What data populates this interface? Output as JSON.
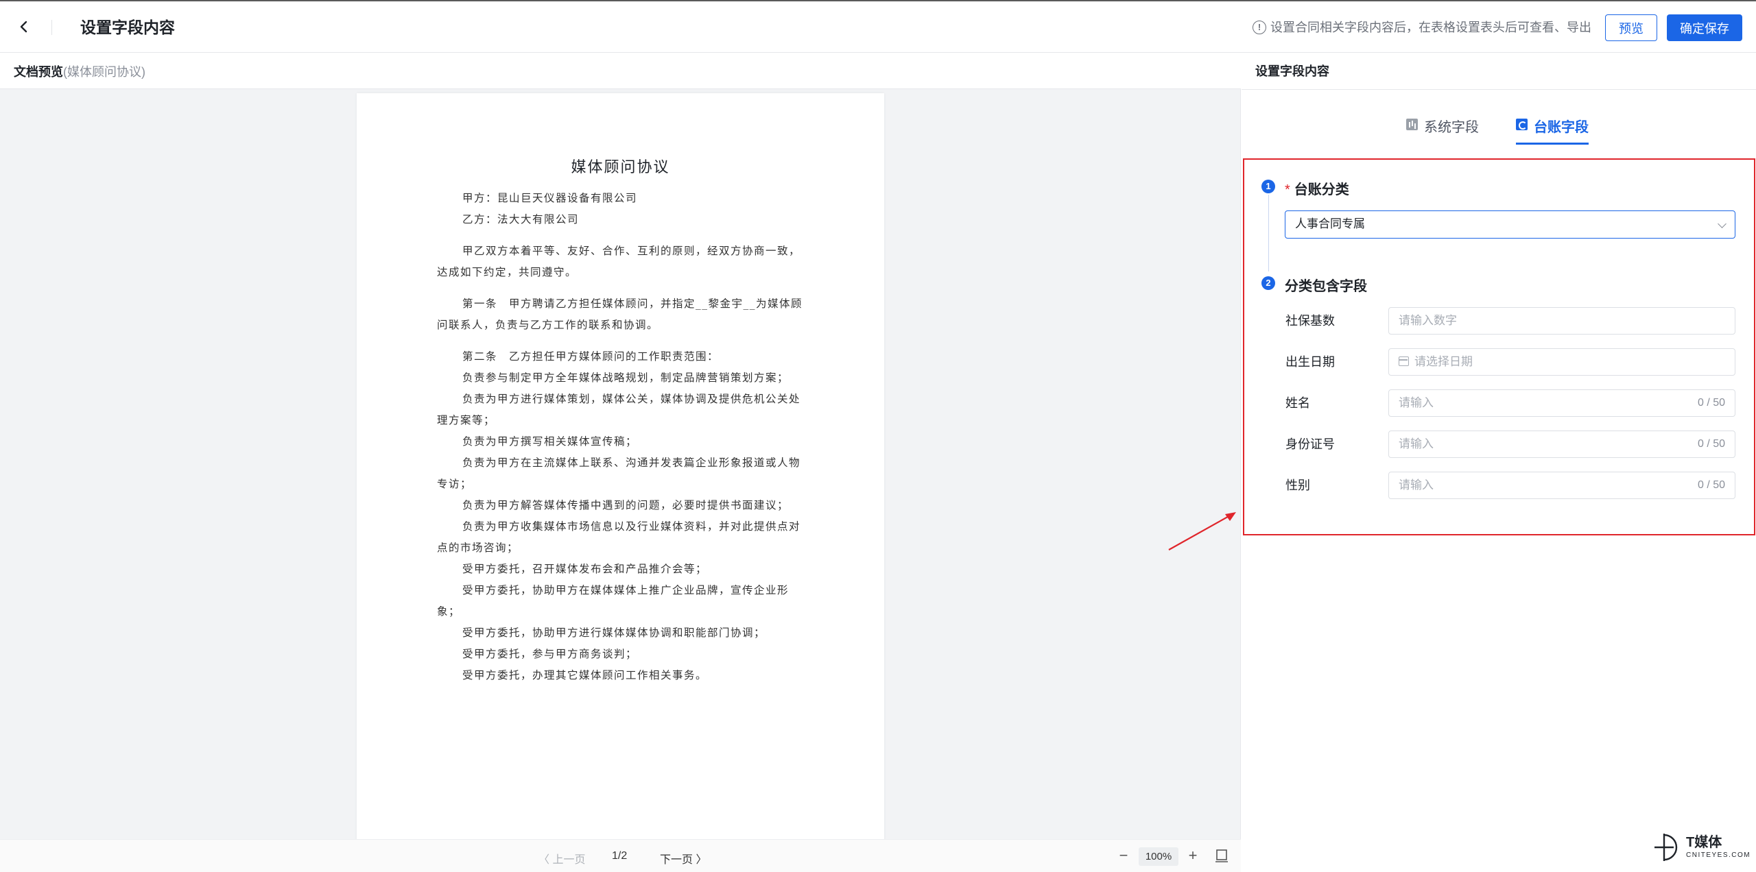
{
  "header": {
    "title": "设置字段内容",
    "hint": "设置合同相关字段内容后，在表格设置表头后可查看、导出",
    "preview_label": "预览",
    "save_label": "确定保存"
  },
  "left": {
    "title": "文档预览",
    "subtitle": "(媒体顾问协议)",
    "document": {
      "title": "媒体顾问协议",
      "party_a": "甲方：昆山巨天仪器设备有限公司",
      "party_b": "乙方：法大大有限公司",
      "preamble": "甲乙双方本着平等、友好、合作、互利的原则，经双方协商一致，达成如下约定，共同遵守。",
      "article1": "第一条　甲方聘请乙方担任媒体顾问，并指定__黎金宇__为媒体顾问联系人，负责与乙方工作的联系和协调。",
      "article2_title": "第二条　乙方担任甲方媒体顾问的工作职责范围：",
      "duties": [
        "负责参与制定甲方全年媒体战略规划，制定品牌营销策划方案；",
        "负责为甲方进行媒体策划，媒体公关，媒体协调及提供危机公关处理方案等；",
        "负责为甲方撰写相关媒体宣传稿；",
        "负责为甲方在主流媒体上联系、沟通并发表篇企业形象报道或人物专访；",
        "负责为甲方解答媒体传播中遇到的问题，必要时提供书面建议；",
        "负责为甲方收集媒体市场信息以及行业媒体资料，并对此提供点对点的市场咨询；",
        "受甲方委托，召开媒体发布会和产品推介会等；",
        "受甲方委托，协助甲方在媒体媒体上推广企业品牌，宣传企业形象；",
        "受甲方委托，协助甲方进行媒体媒体协调和职能部门协调；",
        "受甲方委托，参与甲方商务谈判；",
        "受甲方委托，办理其它媒体顾问工作相关事务。"
      ]
    },
    "pager": {
      "prev": "〈 上一页",
      "page": "1/2",
      "next": "下一页 〉",
      "zoom_minus": "−",
      "zoom": "100%",
      "zoom_plus": "+"
    }
  },
  "right": {
    "title": "设置字段内容",
    "tabs": [
      {
        "label": "系统字段",
        "icon": "chart-icon",
        "active": false
      },
      {
        "label": "台账字段",
        "icon": "ledger-icon",
        "active": true
      }
    ],
    "step1": {
      "num": "1",
      "label": "台账分类",
      "required": "*",
      "selected": "人事合同专属"
    },
    "step2": {
      "num": "2",
      "label": "分类包含字段"
    },
    "fields": [
      {
        "label": "社保基数",
        "placeholder": "请输入数字",
        "counter": ""
      },
      {
        "label": "出生日期",
        "placeholder": "请选择日期",
        "counter": ""
      },
      {
        "label": "姓名",
        "placeholder": "请输入",
        "counter": "0 / 50"
      },
      {
        "label": "身份证号",
        "placeholder": "请输入",
        "counter": "0 / 50"
      },
      {
        "label": "性别",
        "placeholder": "请输入",
        "counter": "0 / 50"
      }
    ]
  },
  "brand": {
    "name": "T媒体",
    "sub": "CNITEYES.COM"
  },
  "colors": {
    "accent": "#1b66e6",
    "highlight": "#e0252b"
  }
}
